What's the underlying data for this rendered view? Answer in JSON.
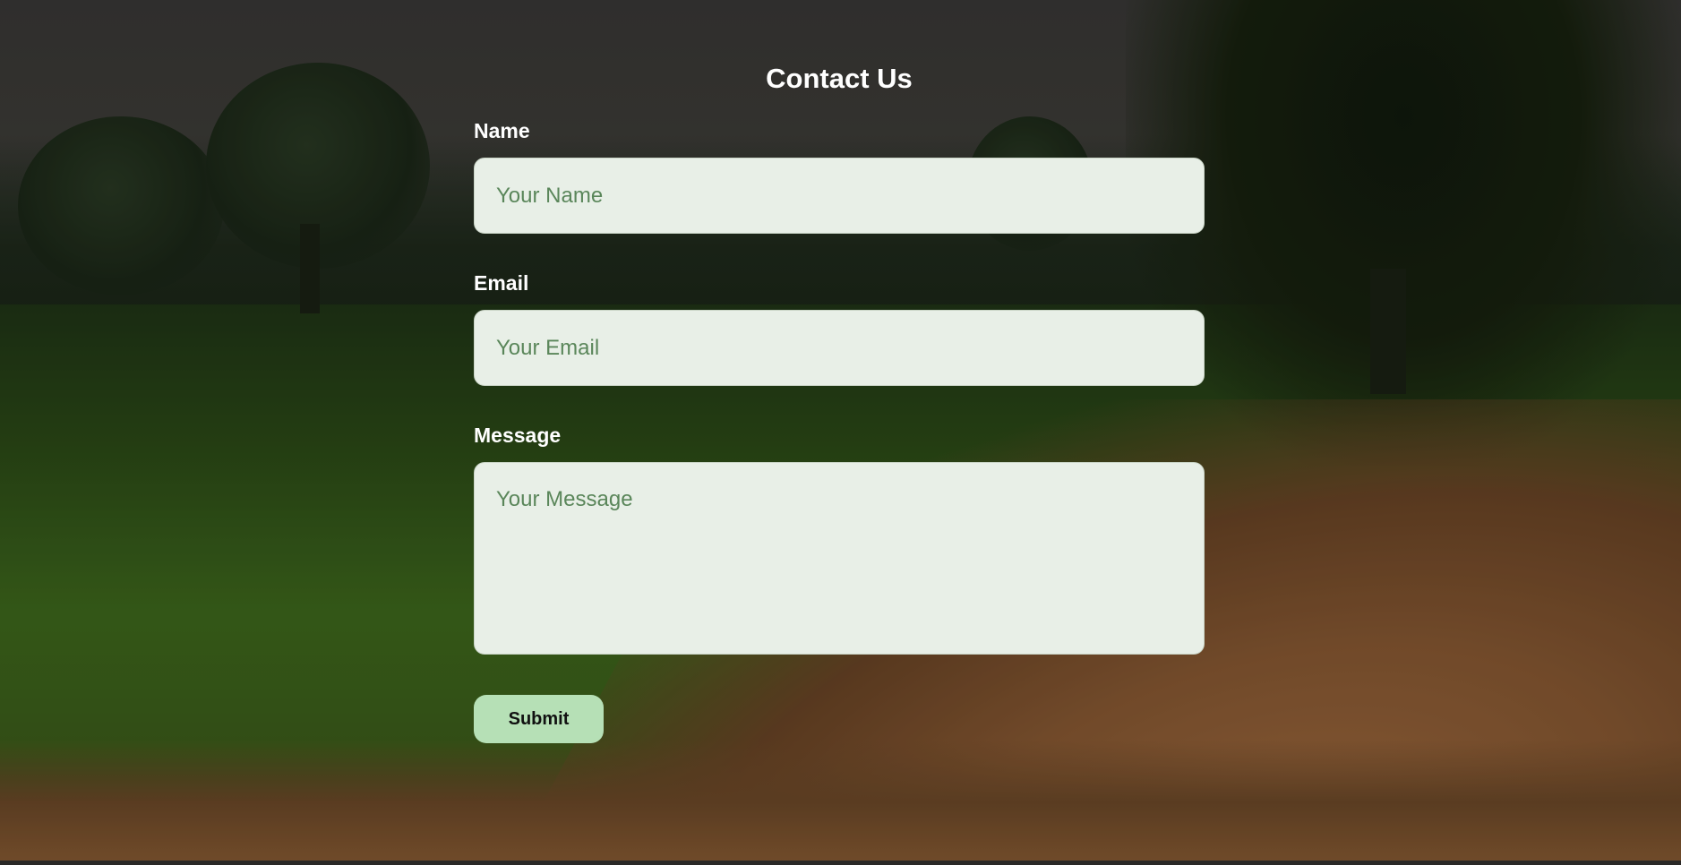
{
  "form": {
    "title": "Contact Us",
    "name_label": "Name",
    "name_placeholder": "Your Name",
    "email_label": "Email",
    "email_placeholder": "Your Email",
    "message_label": "Message",
    "message_placeholder": "Your Message",
    "submit_label": "Submit"
  },
  "colors": {
    "input_background": "#e8efe7",
    "placeholder_text": "#5a865a",
    "submit_background": "#b6e0b6",
    "label_text": "#ffffff"
  }
}
